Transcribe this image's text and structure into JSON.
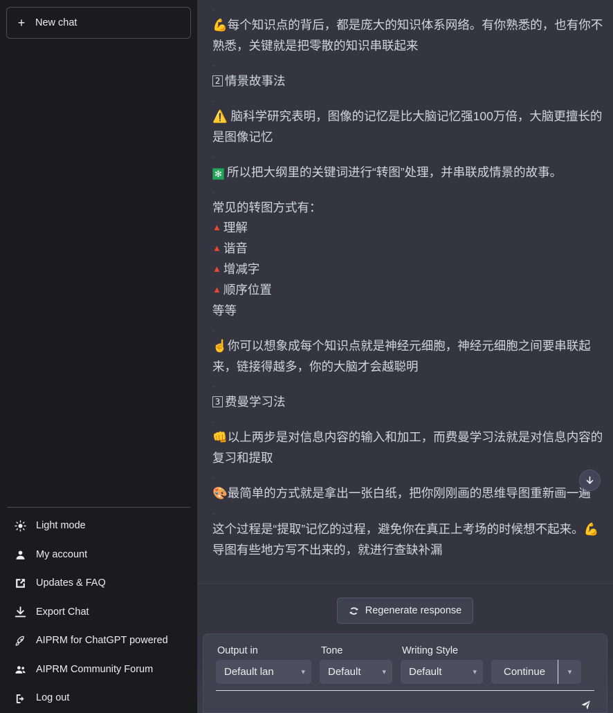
{
  "sidebar": {
    "new_chat_label": "New chat",
    "bottom_items": [
      {
        "label": "Light mode",
        "icon": "sun-icon"
      },
      {
        "label": "My account",
        "icon": "user-icon"
      },
      {
        "label": "Updates & FAQ",
        "icon": "external-link-icon"
      },
      {
        "label": "Export Chat",
        "icon": "download-icon"
      },
      {
        "label": "AIPRM for ChatGPT powered",
        "icon": "rocket-icon"
      },
      {
        "label": "AIPRM Community Forum",
        "icon": "users-icon"
      },
      {
        "label": "Log out",
        "icon": "logout-icon"
      }
    ]
  },
  "conversation": {
    "blocks": [
      {
        "type": "sep",
        "text": "."
      },
      {
        "type": "para",
        "emoji": "💪",
        "text": "每个知识点的背后，都是庞大的知识体系网络。有你熟悉的，也有你不熟悉，关键就是把零散的知识串联起来"
      },
      {
        "type": "sep",
        "text": "."
      },
      {
        "type": "heading",
        "keycap": "2",
        "text": "情景故事法"
      },
      {
        "type": "sep",
        "text": "."
      },
      {
        "type": "para",
        "emoji": "⚠️",
        "text": "脑科学研究表明，图像的记忆是比大脑记忆强100万倍，大脑更擅长的是图像记忆"
      },
      {
        "type": "sep",
        "text": "."
      },
      {
        "type": "para-green",
        "badge": "✻",
        "text": "所以把大纲里的关键词进行“转图”处理，并串联成情景的故事。"
      },
      {
        "type": "sep",
        "text": "."
      },
      {
        "type": "plain",
        "text": "常见的转图方式有："
      },
      {
        "type": "bullet",
        "text": "理解"
      },
      {
        "type": "bullet",
        "text": "谐音"
      },
      {
        "type": "bullet",
        "text": "增减字"
      },
      {
        "type": "bullet",
        "text": "顺序位置"
      },
      {
        "type": "plain",
        "text": "等等"
      },
      {
        "type": "sep",
        "text": "."
      },
      {
        "type": "para",
        "emoji": "☝️",
        "text": "你可以想象成每个知识点就是神经元细胞，神经元细胞之间要串联起来，链接得越多，你的大脑才会越聪明"
      },
      {
        "type": "sep",
        "text": "."
      },
      {
        "type": "heading",
        "keycap": "3",
        "text": "费曼学习法"
      },
      {
        "type": "sep",
        "text": "."
      },
      {
        "type": "para",
        "emoji": "👊",
        "text": "以上两步是对信息内容的输入和加工，而费曼学习法就是对信息内容的复习和提取"
      },
      {
        "type": "sep",
        "text": "."
      },
      {
        "type": "para",
        "emoji": "🎨",
        "text": "最简单的方式就是拿出一张白纸，把你刚刚画的思维导图重新画一遍"
      },
      {
        "type": "sep",
        "text": "."
      },
      {
        "type": "para-tail",
        "text": "这个过程是“提取”记忆的过程，避免你在真正上考场的时候想不起来。",
        "emoji": "💪",
        "tail": "导图有些地方写不出来的，就进行查缺补漏"
      }
    ]
  },
  "toolbar": {
    "regenerate_label": "Regenerate response",
    "regenerate_icon": "refresh-icon",
    "scroll_down_icon": "arrow-down-icon",
    "send_icon": "send-icon"
  },
  "composer": {
    "selectors": [
      {
        "label": "Output in",
        "value": "Default lan",
        "name": "output-language"
      },
      {
        "label": "Tone",
        "value": "Default",
        "name": "tone"
      },
      {
        "label": "Writing Style",
        "value": "Default",
        "name": "writing-style"
      }
    ],
    "continue_label": "Continue"
  },
  "colors": {
    "sidebar_bg": "#1b1b1d",
    "main_bg": "#343541",
    "pill_bg": "#4d4e5e",
    "accent_green": "#23a55a",
    "bullet_red": "#e8482b",
    "text": "#ececf1"
  }
}
